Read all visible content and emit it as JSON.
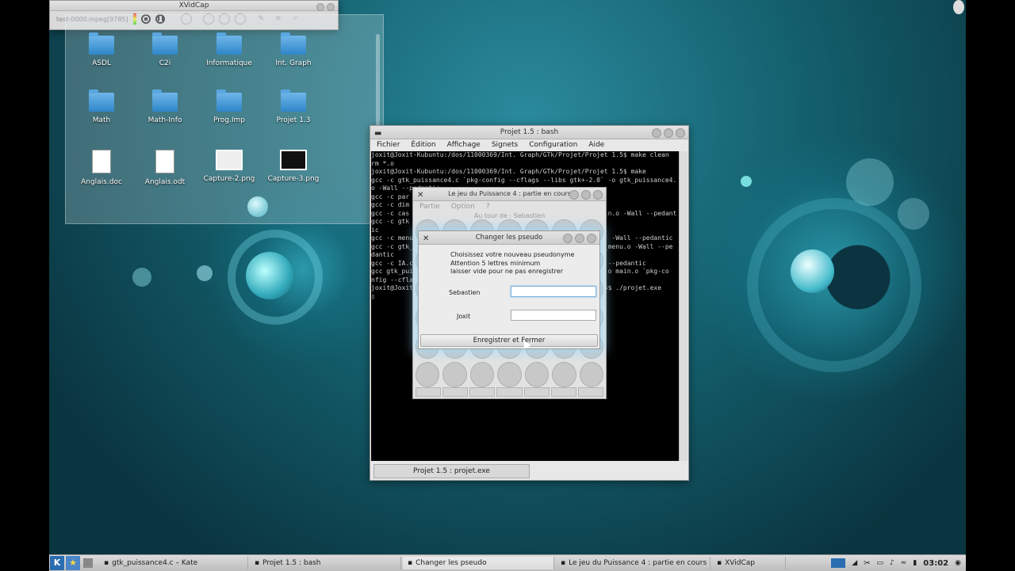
{
  "xvidcap": {
    "title": "XVidCap",
    "file": "test-0000.mpeg[9785]"
  },
  "folder_view": {
    "items": [
      {
        "label": "ASDL",
        "kind": "folder"
      },
      {
        "label": "C2i",
        "kind": "folder"
      },
      {
        "label": "Informatique",
        "kind": "folder"
      },
      {
        "label": "Int. Graph",
        "kind": "folder"
      },
      {
        "label": "Math",
        "kind": "folder"
      },
      {
        "label": "Math-Info",
        "kind": "folder"
      },
      {
        "label": "Prog.Imp",
        "kind": "folder"
      },
      {
        "label": "Projet 1.3",
        "kind": "folder"
      },
      {
        "label": "Anglais.doc",
        "kind": "document"
      },
      {
        "label": "Anglais.odt",
        "kind": "document"
      },
      {
        "label": "Capture-2.png",
        "kind": "image"
      },
      {
        "label": "Capture-3.png",
        "kind": "image-dark"
      }
    ]
  },
  "konsole": {
    "title": "Projet 1.5 : bash",
    "menu": [
      "Fichier",
      "Édition",
      "Affichage",
      "Signets",
      "Configuration",
      "Aide"
    ],
    "lines": [
      "joxit@Joxit-Kubuntu:/dos/11000369/Int. Graph/GTk/Projet/Projet 1.5$ make clean",
      "rm *.o",
      "joxit@Joxit-Kubuntu:/dos/11000369/Int. Graph/GTk/Projet/Projet 1.5$ make",
      "gcc -c gtk_puissance4.c `pkg-config --cflags --libs gtk+-2.0` -o gtk_puissance4.",
      "o -Wall --pedantic",
      "gcc -c par",
      "gcc -c dim",
      "gcc -c cas                                                  ain.o -Wall --pedant",
      "gcc -c gtk",
      "ic",
      "gcc -c menu                                                    -Wall --pedantic",
      "gcc -c gtk_                                                  _menu.o -Wall --pe",
      "dantic",
      "gcc -c IA.c                                                ll --pedantic",
      "gcc gtk_pui                                                IA.o main.o `pkg-co",
      "nfig --cfla",
      "joxit@Joxit                                                1.5$ ./projet.exe",
      "▯"
    ],
    "tab": "Projet 1.5 : projet.exe"
  },
  "game": {
    "title": "Le jeu du Puissance 4 : partie en cours",
    "menu": [
      "Partie",
      "Option",
      "?"
    ],
    "status": "Au tour de : Sebastien"
  },
  "dialog": {
    "title": "Changer les pseudo",
    "instructions": [
      "Choisissez votre nouveau pseudonyme",
      "Attention 5 lettres minimum",
      "laisser vide pour ne pas enregistrer"
    ],
    "player1_label": "Sebastien",
    "player1_value": "",
    "player2_label": "Joxit",
    "player2_value": "",
    "save_button": "Enregistrer et Fermer"
  },
  "taskbar": {
    "tasks": [
      "gtk_puissance4.c – Kate",
      "Projet 1.5 : bash",
      "Changer les pseudo",
      "Le jeu du Puissance 4 : partie en cours",
      "XVidCap"
    ],
    "clock": "03:02"
  }
}
